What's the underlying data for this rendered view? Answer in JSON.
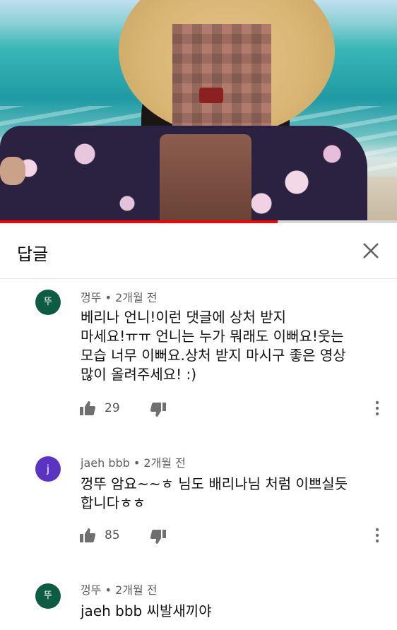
{
  "video": {
    "progress": 0.7
  },
  "header": {
    "title": "답글"
  },
  "icons": {
    "close": "close-icon",
    "like": "thumbs-up-icon",
    "dislike": "thumbs-down-icon",
    "more": "more-vertical-icon"
  },
  "colors": {
    "progress_played": "#ff0000",
    "avatar_green": "#0b5c43",
    "avatar_purple": "#5b33c2"
  },
  "comments": [
    {
      "avatar": "뚜",
      "author": "껑뚜",
      "time": "2개월 전",
      "lines": [
        "베리나 언니!이런 댓글에 상처 받지",
        "마세요!ㅠㅠ 언니는 누가 뭐래도 이뻐요!웃는",
        "모습 너무 이뻐요.상처 받지 마시구 좋은 영상",
        "많이 올려주세요! :)"
      ],
      "likes": "29"
    },
    {
      "avatar": "j",
      "author": "jaeh bbb",
      "time": "2개월 전",
      "lines": [
        "껑뚜 암요~~ㅎ 님도 배리나님 처럼 이쁘실듯",
        "합니다ㅎㅎ"
      ],
      "likes": "85"
    },
    {
      "avatar": "뚜",
      "author": "껑뚜",
      "time": "2개월 전",
      "lines": [
        "jaeh bbb 씨발새끼야"
      ]
    }
  ]
}
